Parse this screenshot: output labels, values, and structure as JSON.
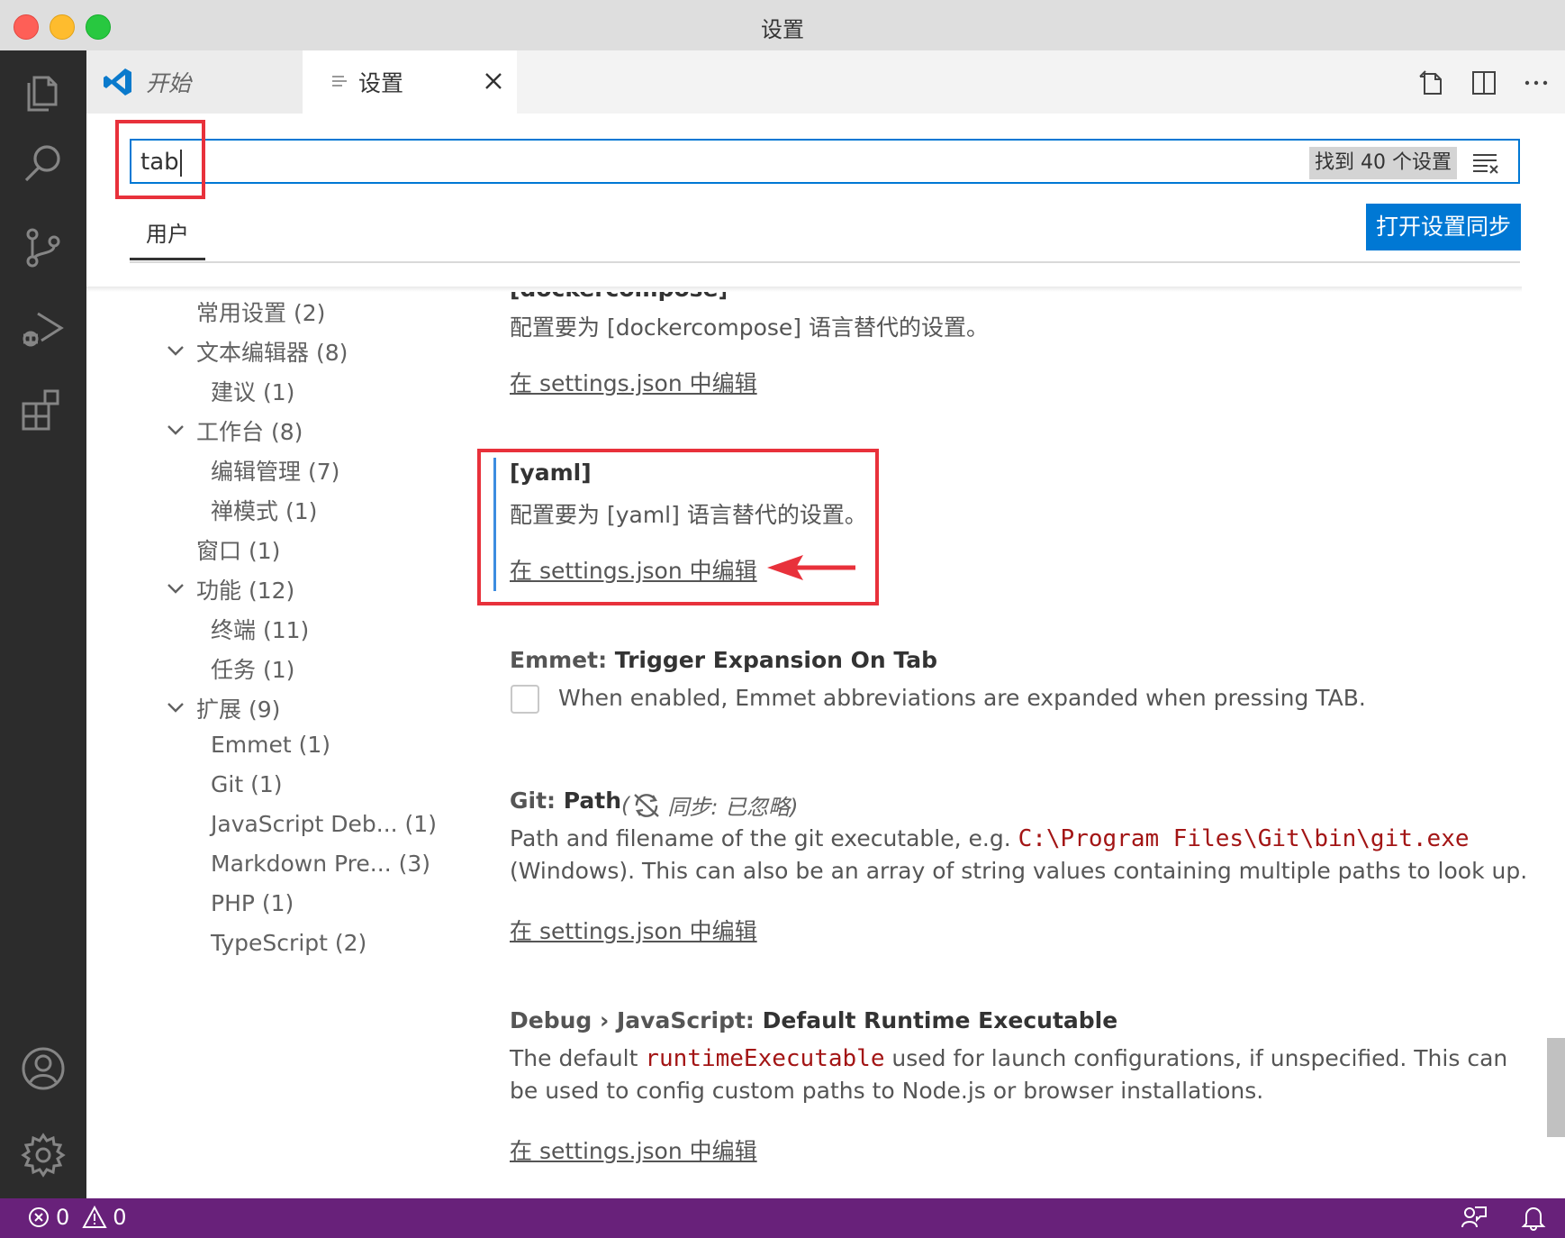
{
  "window": {
    "title": "设置"
  },
  "tabs": [
    {
      "label": "开始",
      "active": false
    },
    {
      "label": "设置",
      "active": true
    }
  ],
  "search": {
    "value": "tab",
    "result_badge": "找到 40 个设置"
  },
  "scope_tab": "用户",
  "sync_button": "打开设置同步",
  "toc": [
    {
      "label": "常用设置 (2)",
      "level": 1,
      "expanded": null
    },
    {
      "label": "文本编辑器 (8)",
      "level": 1,
      "expanded": true
    },
    {
      "label": "建议 (1)",
      "level": 2,
      "expanded": null
    },
    {
      "label": "工作台 (8)",
      "level": 1,
      "expanded": true
    },
    {
      "label": "编辑管理 (7)",
      "level": 2,
      "expanded": null
    },
    {
      "label": "禅模式 (1)",
      "level": 2,
      "expanded": null
    },
    {
      "label": "窗口 (1)",
      "level": 1,
      "expanded": null
    },
    {
      "label": "功能 (12)",
      "level": 1,
      "expanded": true
    },
    {
      "label": "终端 (11)",
      "level": 2,
      "expanded": null
    },
    {
      "label": "任务 (1)",
      "level": 2,
      "expanded": null
    },
    {
      "label": "扩展 (9)",
      "level": 1,
      "expanded": true
    },
    {
      "label": "Emmet (1)",
      "level": 2,
      "expanded": null
    },
    {
      "label": "Git (1)",
      "level": 2,
      "expanded": null
    },
    {
      "label": "JavaScript Deb... (1)",
      "level": 2,
      "expanded": null
    },
    {
      "label": "Markdown Pre...  (3)",
      "level": 2,
      "expanded": null
    },
    {
      "label": "PHP (1)",
      "level": 2,
      "expanded": null
    },
    {
      "label": "TypeScript (2)",
      "level": 2,
      "expanded": null
    }
  ],
  "settings": {
    "dockercompose": {
      "partial_title": "[dockercompose]",
      "description": "配置要为 [dockercompose] 语言替代的设置。",
      "edit_link": "在 settings.json 中编辑"
    },
    "yaml": {
      "title": "[yaml]",
      "description": "配置要为 [yaml] 语言替代的设置。",
      "edit_link": "在 settings.json 中编辑"
    },
    "emmet": {
      "category": "Emmet: ",
      "name": "Trigger Expansion On Tab",
      "description": "When enabled, Emmet abbreviations are expanded when pressing TAB.",
      "checked": false
    },
    "git_path": {
      "category": "Git: ",
      "name": "Path",
      "sync_note": "同步: 已忽略)",
      "sync_paren": "(",
      "description_pre": "Path and filename of the git executable, e.g. ",
      "description_code": "C:\\Program Files\\Git\\bin\\git.exe",
      "description_post": "(Windows). This can also be an array of string values containing multiple paths to look up.",
      "edit_link": "在 settings.json 中编辑"
    },
    "debug_runtime": {
      "category": "Debug › JavaScript: ",
      "name": "Default Runtime Executable",
      "description_pre": "The default ",
      "description_code": "runtimeExecutable",
      "description_post": " used for launch configurations, if unspecified. This can",
      "description_line2": "be used to config custom paths to Node.js or browser installations.",
      "edit_link": "在 settings.json 中编辑"
    }
  },
  "status": {
    "errors": "0",
    "warnings": "0"
  },
  "colors": {
    "accent": "#0078d4",
    "statusbar": "#68217a",
    "highlight": "#e8313b",
    "code": "#a31515"
  },
  "icons": {
    "activity": [
      "explorer-icon",
      "search-icon",
      "source-control-icon",
      "run-debug-icon",
      "extensions-icon",
      "account-icon",
      "manage-gear-icon"
    ],
    "tab_actions": [
      "open-settings-json-icon",
      "split-editor-icon",
      "more-actions-icon"
    ],
    "status_right": [
      "feedback-icon",
      "notifications-bell-icon"
    ]
  }
}
